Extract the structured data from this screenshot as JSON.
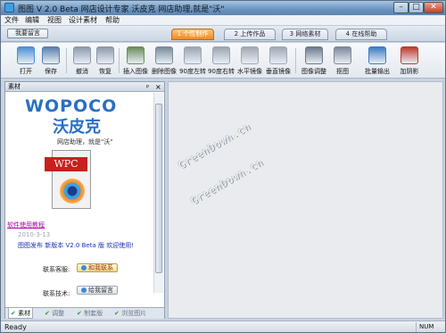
{
  "window": {
    "title": "图图 V 2.0 Beta 网店设计专家 沃皮克 网店助理,就是\"沃\"",
    "min": "–",
    "max": "□",
    "close": "✕"
  },
  "menu": [
    "文件",
    "编辑",
    "视图",
    "设计素材",
    "帮助"
  ],
  "ribbon": {
    "message_button": "我要留言",
    "tabs": [
      "1 个性制作",
      "2 上传作品",
      "3 网络素材",
      "4 在线帮助"
    ],
    "active_tab": 0
  },
  "toolbar": [
    {
      "label": "打开",
      "icon": "open-icon",
      "color": "#4a8fd6"
    },
    {
      "label": "保存",
      "icon": "save-icon",
      "color": "#5a7fb0"
    },
    {
      "label": "撤消",
      "icon": "undo-icon",
      "color": "#8c9aab"
    },
    {
      "label": "恢复",
      "icon": "redo-icon",
      "color": "#8c9aab"
    },
    {
      "label": "插入图像",
      "icon": "insert-image-icon",
      "color": "#6a8d5a"
    },
    {
      "label": "删除图像",
      "icon": "delete-image-icon",
      "color": "#7a8a9a"
    },
    {
      "label": "90度左转",
      "icon": "rotate-left-icon",
      "color": "#9aa5b2"
    },
    {
      "label": "90度右转",
      "icon": "rotate-right-icon",
      "color": "#9aa5b2"
    },
    {
      "label": "水平镜像",
      "icon": "flip-horizontal-icon",
      "color": "#a0a8b4"
    },
    {
      "label": "垂直镜像",
      "icon": "flip-vertical-icon",
      "color": "#a0a8b4"
    },
    {
      "label": "图像调整",
      "icon": "image-adjust-icon",
      "color": "#6b7a8c"
    },
    {
      "label": "抠图",
      "icon": "cutout-icon",
      "color": "#7d8898"
    },
    {
      "label": "批量输出",
      "icon": "batch-output-icon",
      "color": "#3d7cc4"
    },
    {
      "label": "加阴影",
      "icon": "add-shadow-icon",
      "color": "#c0392b"
    }
  ],
  "panel": {
    "title": "素材",
    "pin": "ᵖ",
    "close": "×",
    "logo_text": "WOPOCO",
    "logo_cn": "沃皮克",
    "slogan": "网店助理，就是\"沃\"",
    "doc_badge": "WPC",
    "doc_link": "软件使用教程",
    "date": "2010-3-13",
    "release": "图图发布 新版本 V2.0 Beta 版 欢迎使用!",
    "support_label": "联系客服:",
    "support_button": "和我联系",
    "tech_label": "联系技术:",
    "tech_button": "给我留言",
    "bottom_tabs": [
      "素材",
      "调整",
      "制套版",
      "浏览图片"
    ]
  },
  "workspace": {
    "watermarks": [
      "GreenDown.cn",
      "GreenDown.cn"
    ]
  },
  "status": {
    "text": "Ready",
    "num": "NUM"
  }
}
